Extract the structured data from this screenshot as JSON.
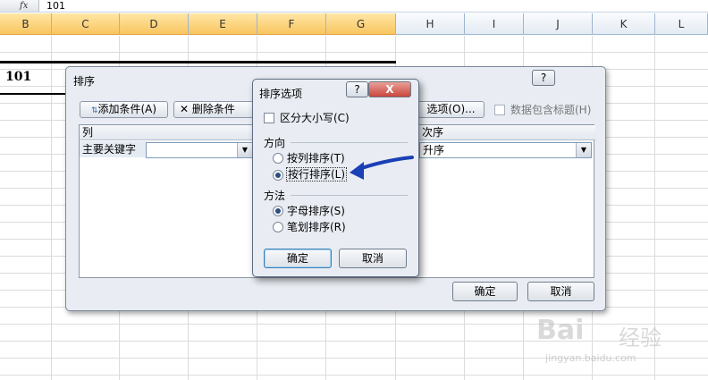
{
  "formula_bar": {
    "fx_label": "fx",
    "value": "101"
  },
  "columns": [
    "B",
    "C",
    "D",
    "E",
    "F",
    "G",
    "H",
    "I",
    "J",
    "K",
    "L"
  ],
  "cell_value": "101",
  "sort_dialog": {
    "title": "排序",
    "help_button": "?",
    "add_condition": "添加条件(A)",
    "delete_condition": "删除条件",
    "options_button": "选项(O)...",
    "header_checkbox": "数据包含标题(H)",
    "column_header": "列",
    "order_header": "次序",
    "primary_key_label": "主要关键字",
    "order_value": "升序",
    "ok": "确定",
    "cancel": "取消"
  },
  "options_dialog": {
    "title": "排序选项",
    "help_button": "?",
    "close_button": "X",
    "case_sensitive": "区分大小写(C)",
    "direction_label": "方向",
    "by_column": "按列排序(T)",
    "by_row": "按行排序(L)",
    "method_label": "方法",
    "alphabetic": "字母排序(S)",
    "stroke": "笔划排序(R)",
    "ok": "确定",
    "cancel": "取消"
  },
  "colors": {
    "arrow": "#1b3fb4",
    "accent_header": "#f9c560",
    "close_red": "#c9463d"
  },
  "watermark": {
    "brand": "Bai",
    "brand_suffix": "经验",
    "url": "jingyan.baidu.com"
  }
}
